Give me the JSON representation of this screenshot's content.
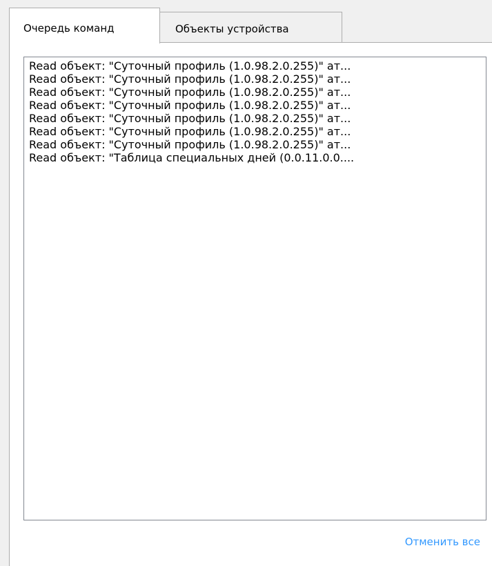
{
  "tabs": [
    {
      "label": "Очередь команд",
      "active": true
    },
    {
      "label": "Объекты устройства",
      "active": false
    }
  ],
  "queue": {
    "items": [
      "Read объект: \"Суточный профиль (1.0.98.2.0.255)\" ат...",
      "Read объект: \"Суточный профиль (1.0.98.2.0.255)\" ат...",
      "Read объект: \"Суточный профиль (1.0.98.2.0.255)\" ат...",
      "Read объект: \"Суточный профиль (1.0.98.2.0.255)\" ат...",
      "Read объект: \"Суточный профиль (1.0.98.2.0.255)\" ат...",
      "Read объект: \"Суточный профиль (1.0.98.2.0.255)\" ат...",
      "Read объект: \"Суточный профиль (1.0.98.2.0.255)\" ат...",
      "Read объект: \"Таблица специальных дней (0.0.11.0.0...."
    ]
  },
  "actions": {
    "cancel_all_label": "Отменить все"
  },
  "colors": {
    "link": "#3399ff",
    "border": "#adadad",
    "window_bg": "#f0f0f0"
  }
}
